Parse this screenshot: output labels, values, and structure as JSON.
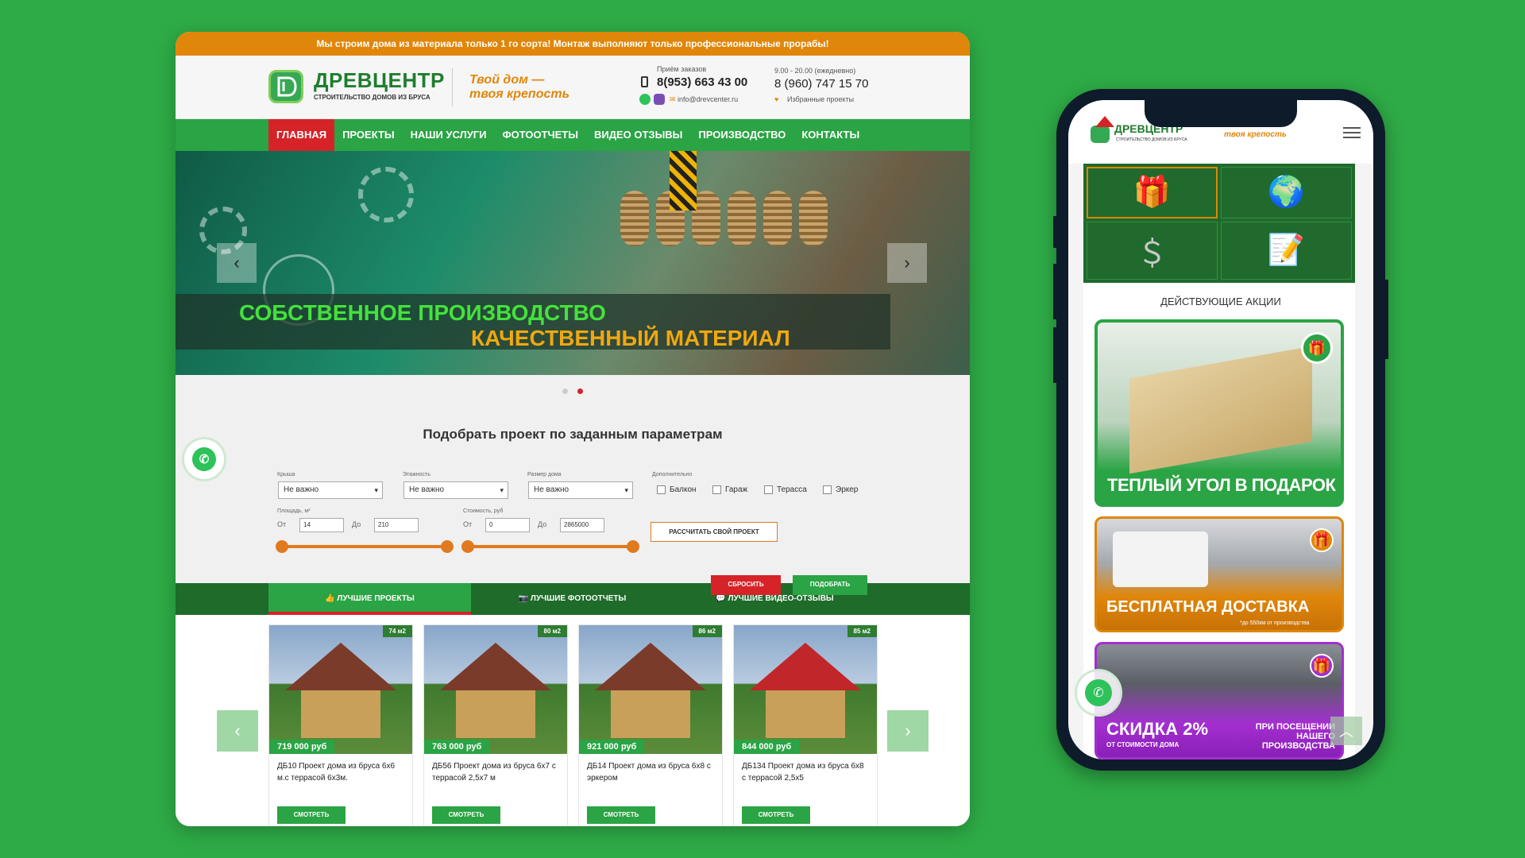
{
  "desktop": {
    "topbar_text": "Мы строим дома из материала только 1 го сорта! Монтаж выполняют только профессиональные прорабы!",
    "logo_title": "ДРЕВЦЕНТР",
    "logo_subtitle": "СТРОИТЕЛЬСТВО ДОМОВ ИЗ БРУСА",
    "slogan_line1": "Твой дом —",
    "slogan_line2": "твоя крепость",
    "order_label": "Приём заказов",
    "phone1": "8(953) 663 43 00",
    "hours": "9.00 - 20.00 (ежедневно)",
    "phone2": "8 (960) 747 15 70",
    "email": "info@drevcenter.ru",
    "favorites": "Избранные проекты",
    "nav": [
      "ГЛАВНАЯ",
      "ПРОЕКТЫ",
      "НАШИ УСЛУГИ",
      "ФОТООТЧЕТЫ",
      "ВИДЕО ОТЗЫВЫ",
      "ПРОИЗВОДСТВО",
      "КОНТАКТЫ"
    ],
    "hero_line1": "СОБСТВЕННОЕ ПРОИЗВОДСТВО",
    "hero_line2": "КАЧЕСТВЕННЫЙ МАТЕРИАЛ",
    "filter_title": "Подобрать проект по заданным параметрам",
    "roof_label": "Крыша",
    "floors_label": "Этажность",
    "size_label": "Размер дома",
    "extra_label": "Дополнительно",
    "roof_value": "Не важно",
    "floors_value": "Не важно",
    "size_value": "Не важно",
    "extras": [
      "Балкон",
      "Гараж",
      "Терасса",
      "Эркер"
    ],
    "area_label": "Площадь, м²",
    "cost_label": "Стоимость, руб",
    "from": "От",
    "to": "До",
    "area_from": "14",
    "area_to": "210",
    "cost_from": "0",
    "cost_to": "2865000",
    "calc_button": "РАССЧИТАТЬ СВОЙ ПРОЕКТ",
    "reset_button": "СБРОСИТЬ",
    "pick_button": "ПОДОБРАТЬ",
    "tabs": [
      "ЛУЧШИЕ ПРОЕКТЫ",
      "ЛУЧШИЕ ФОТООТЧЕТЫ",
      "ЛУЧШИЕ ВИДЕО-ОТЗЫВЫ"
    ],
    "cards": [
      {
        "area": "74 м2",
        "price": "719 000 руб",
        "desc": "ДБ10 Проект дома из бруса 6х6 м.с террасой 6х3м.",
        "button": "СМОТРЕТЬ"
      },
      {
        "area": "80 м2",
        "price": "763 000 руб",
        "desc": "ДБ56 Проект дома из бруса 6х7 с террасой 2,5х7 м",
        "button": "СМОТРЕТЬ"
      },
      {
        "area": "86 м2",
        "price": "921 000 руб",
        "desc": "ДБ14 Проект дома из бруса 6х8 с эркером",
        "button": "СМОТРЕТЬ"
      },
      {
        "area": "85 м2",
        "price": "844 000 руб",
        "desc": "ДБ134 Проект дома из бруса 6х8 с террасой 2,5х5",
        "button": "СМОТРЕТЬ"
      }
    ]
  },
  "mobile": {
    "logo_title": "ДРЕВЦЕНТР",
    "logo_subtitle": "СТРОИТЕЛЬСТВО ДОМОВ ИЗ БРУСА",
    "slogan_line1": "Твой дом —",
    "slogan_line2": "твоя крепость",
    "section_title": "ДЕЙСТВУЮЩИЕ АКЦИИ",
    "promo1": "ТЕПЛЫЙ УГОЛ В ПОДАРОК",
    "promo2": "БЕСПЛАТНАЯ ДОСТАВКА",
    "promo2_note": "*до 550км от производства",
    "promo3_big": "СКИДКА 2%",
    "promo3_small": "ОТ СТОИМОСТИ ДОМА",
    "promo3_right1": "ПРИ ПОСЕЩЕНИИ",
    "promo3_right2": "НАШЕГО ПРОИЗВОДСТВА"
  },
  "colors": {
    "green": "#2aa444",
    "orange": "#e0860a",
    "red": "#d62328",
    "dark_green": "#1e6b2a",
    "background": "#2eab46"
  },
  "icons": [
    "phone-icon",
    "whatsapp-icon",
    "viber-icon",
    "mail-icon",
    "heart-icon",
    "gift-icon",
    "globe-icon",
    "dollar-icon",
    "document-icon",
    "menu-icon"
  ]
}
